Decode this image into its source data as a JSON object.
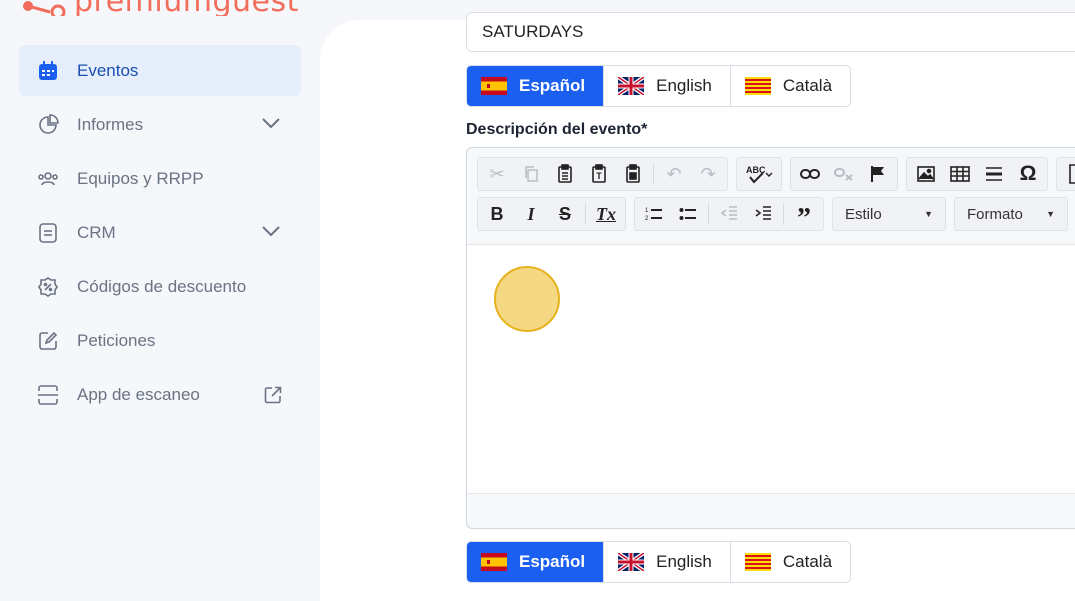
{
  "brand": {
    "name": "premiumguest",
    "color": "#f26d5b"
  },
  "sidebar": {
    "items": [
      {
        "label": "Eventos",
        "icon": "calendar-icon",
        "active": true
      },
      {
        "label": "Informes",
        "icon": "pie-chart-icon",
        "expandable": true
      },
      {
        "label": "Equipos y RRPP",
        "icon": "users-icon"
      },
      {
        "label": "CRM",
        "icon": "document-icon",
        "expandable": true
      },
      {
        "label": "Códigos de descuento",
        "icon": "discount-badge-icon"
      },
      {
        "label": "Peticiones",
        "icon": "edit-icon"
      },
      {
        "label": "App de escaneo",
        "icon": "scan-icon",
        "external": true
      }
    ]
  },
  "form": {
    "event_name_value": "SATURDAYS",
    "description_label": "Descripción del evento*",
    "languages": [
      {
        "label": "Español",
        "active": true
      },
      {
        "label": "English",
        "active": false
      },
      {
        "label": "Català",
        "active": false
      }
    ]
  },
  "editor": {
    "style_combo": "Estilo",
    "format_combo": "Formato"
  },
  "colors": {
    "accent": "#1a5ff0",
    "active_nav_bg": "#e6eefb",
    "active_nav_text": "#1a4fb0"
  }
}
